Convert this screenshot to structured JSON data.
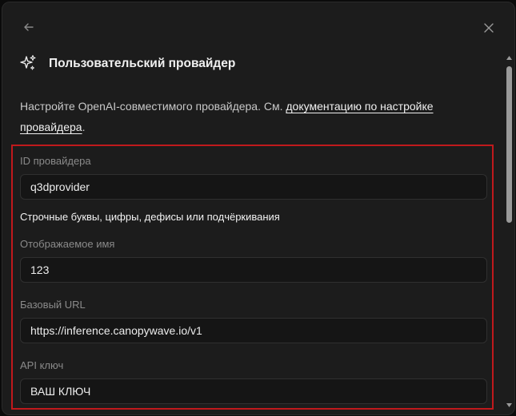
{
  "dialog": {
    "title": "Пользовательский провайдер",
    "description_prefix": "Настройте OpenAI-совместимого провайдера. См.",
    "description_link": "документацию по настройке провайдера",
    "description_suffix": "."
  },
  "form": {
    "provider_id_label": "ID провайдера",
    "provider_id_value": "q3dprovider",
    "provider_id_hint": "Строчные буквы, цифры, дефисы или подчёркивания",
    "display_name_label": "Отображаемое имя",
    "display_name_value": "123",
    "base_url_label": "Базовый URL",
    "base_url_value": "https://inference.canopywave.io/v1",
    "api_key_label": "API ключ",
    "api_key_value": "ВАШ КЛЮЧ"
  },
  "icons": {
    "back": "arrow-left-icon",
    "close": "close-icon",
    "header": "sparkles-icon"
  },
  "colors": {
    "background": "#1c1c1c",
    "highlight_border": "#c0191c",
    "input_background": "#151515"
  }
}
